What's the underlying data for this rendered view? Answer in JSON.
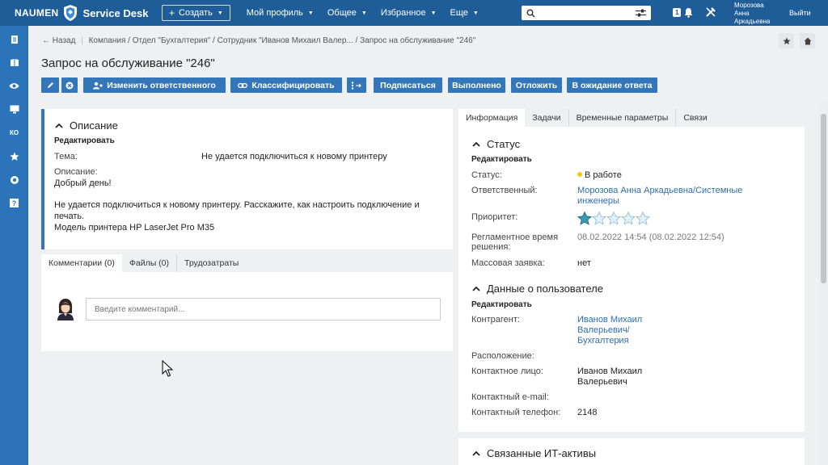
{
  "topbar": {
    "brand": "NAUMEN",
    "product": "Service Desk",
    "create_label": "Создать",
    "menu": [
      "Мой профиль",
      "Общее",
      "Избранное",
      "Еще"
    ],
    "notification_count": "1",
    "user_name_line1": "Морозова",
    "user_name_line2": "Анна",
    "user_name_line3": "Аркадьевна",
    "logout_label": "Выйти"
  },
  "sidebar": {
    "items": [
      "document-icon",
      "book-icon",
      "eye-icon",
      "monitor-icon",
      "КО",
      "star-icon",
      "globe-icon",
      "help-icon"
    ]
  },
  "breadcrumb": {
    "back": "Назад",
    "items": [
      "Компания",
      "Отдел \"Бухгалтерия\"",
      "Сотрудник \"Иванов Михаил Валер...",
      "Запрос на обслуживание \"246\""
    ]
  },
  "page_title": "Запрос на обслуживание \"246\"",
  "actions": {
    "change_responsible": "Изменить ответственного",
    "classify": "Классифицировать",
    "subscribe": "Подписаться",
    "done": "Выполнено",
    "postpone": "Отложить",
    "awaiting": "В ожидание ответа"
  },
  "description": {
    "title": "Описание",
    "edit": "Редактировать",
    "subject_label": "Тема:",
    "subject_value": "Не удается подключиться к новому принтеру",
    "desc_label": "Описание:",
    "desc_line1": "Добрый день!",
    "desc_line2": "Не удается подключиться к новому принтеру. Расскажите, как настроить подключение и",
    "desc_line3": "печать.",
    "desc_line4": "Модель принтера HP LaserJet Pro M35"
  },
  "comment_tabs": [
    "Комментарии (0)",
    "Файлы (0)",
    "Трудозатраты"
  ],
  "comment_placeholder": "Введите комментарий...",
  "info_tabs": [
    "Информация",
    "Задачи",
    "Временные параметры",
    "Связи"
  ],
  "status_section": {
    "title": "Статус",
    "edit": "Редактировать",
    "status_label": "Статус:",
    "status_value": "В работе",
    "status_color": "#f5c518",
    "responsible_label": "Ответственный:",
    "responsible_line1": "Морозова Анна Аркадьевна/Системные",
    "responsible_line2": "инженеры",
    "priority_label": "Приоритет:",
    "priority_stars": 1,
    "priority_max": 5,
    "deadline_label_line1": "Регламентное время",
    "deadline_label_line2": "решения:",
    "deadline_value": "08.02.2022 14:54 (08.02.2022 12:54)",
    "mass_label": "Массовая заявка:",
    "mass_value": "нет"
  },
  "user_section": {
    "title": "Данные о пользователе",
    "edit": "Редактировать",
    "client_label": "Контрагент:",
    "client_line1": "Иванов Михаил",
    "client_line2": "Валерьевич/",
    "client_line3": "Бухгалтерия",
    "location_label": "Расположение:",
    "contact_label": "Контактное лицо:",
    "contact_line1": "Иванов Михаил",
    "contact_line2": "Валерьевич",
    "email_label": "Контактный e-mail:",
    "phone_label": "Контактный телефон:",
    "phone_value": "2148"
  },
  "linked_section": {
    "title": "Связанные ИТ-активы"
  },
  "colors": {
    "topbar": "#1f5d99",
    "sidebar": "#2c74b9",
    "button": "#3377ba",
    "link": "#2f6eab"
  }
}
